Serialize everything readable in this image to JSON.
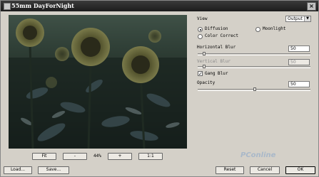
{
  "window": {
    "title": "55mm DayForNight"
  },
  "preview_controls": {
    "fit_label": "Fit",
    "minus_label": "-",
    "zoom_text": "44%",
    "plus_label": "+",
    "one_to_one_label": "1:1"
  },
  "view": {
    "label": "View",
    "selected": "Output"
  },
  "modes": [
    {
      "label": "Diffusion",
      "selected": true
    },
    {
      "label": "Moonlight",
      "selected": false
    },
    {
      "label": "Color Correct",
      "selected": false
    }
  ],
  "horizontal_blur": {
    "label": "Horizontal Blur",
    "value": "50",
    "level": 0.05
  },
  "vertical_blur": {
    "label": "Vertical Blur",
    "value": "50",
    "level": 0.05
  },
  "gang_blur": {
    "label": "Gang Blur",
    "checked": true
  },
  "opacity": {
    "label": "Opacity",
    "value": "50",
    "level": 0.5
  },
  "footer": {
    "load_label": "Load...",
    "save_label": "Save...",
    "reset_label": "Reset",
    "cancel_label": "Cancel",
    "ok_label": "OK"
  },
  "watermark": "PConline"
}
